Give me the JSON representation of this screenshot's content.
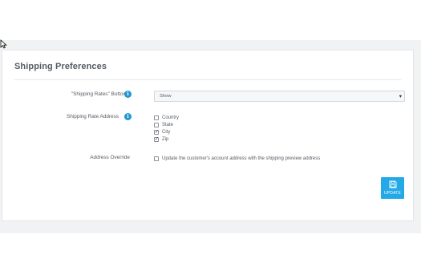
{
  "panel": {
    "title": "Shipping Preferences"
  },
  "fields": {
    "rates_buttons": {
      "label": "\"Shipping Rates\" Buttons:",
      "value": "Show"
    },
    "rate_address": {
      "label": "Shipping Rate Address",
      "options": [
        {
          "label": "Country",
          "checked": false
        },
        {
          "label": "State",
          "checked": false
        },
        {
          "label": "City",
          "checked": true
        },
        {
          "label": "Zip",
          "checked": true
        }
      ]
    },
    "address_override": {
      "label": "Address Override",
      "option_label": "Update the customer's account address with the shipping preview address",
      "checked": false
    }
  },
  "actions": {
    "update_label": "UPDATE",
    "update_icon": "save-icon"
  },
  "colors": {
    "accent": "#22a9e6",
    "info": "#2196d3",
    "background": "#f1f2f4"
  }
}
